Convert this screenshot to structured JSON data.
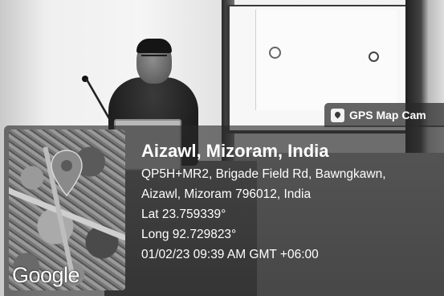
{
  "badge": {
    "label": "GPS Map Cam",
    "icon": "gps-pin-icon"
  },
  "map": {
    "provider_logo": "Google",
    "icon": "location-pin-icon"
  },
  "location": {
    "title": "Aizawl, Mizoram, India",
    "address_line1": "QP5H+MR2, Brigade Field Rd, Bawngkawn,",
    "address_line2": "Aizawl, Mizoram 796012, India",
    "latitude": "Lat 23.759339°",
    "longitude": "Long 92.729823°",
    "timestamp": "01/02/23 09:39 AM GMT +06:00"
  },
  "colors": {
    "overlay": "#282828",
    "text": "#ffffff"
  }
}
